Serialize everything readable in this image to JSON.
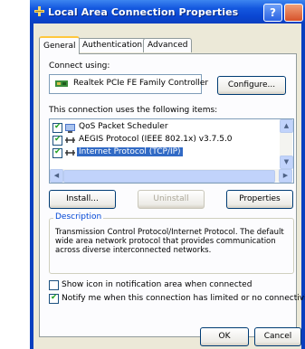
{
  "window": {
    "title": "Local Area Connection Properties",
    "help_label": "?"
  },
  "tabs": [
    {
      "label": "General",
      "active": true
    },
    {
      "label": "Authentication",
      "active": false
    },
    {
      "label": "Advanced",
      "active": false
    }
  ],
  "general": {
    "connect_using_label": "Connect using:",
    "adapter_name": "Realtek PCIe FE Family Controller",
    "configure_label": "Configure...",
    "items_label": "This connection uses the following items:",
    "items": [
      {
        "label": "QoS Packet Scheduler",
        "checked": true,
        "selected": false
      },
      {
        "label": "AEGIS Protocol (IEEE 802.1x) v3.7.5.0",
        "checked": true,
        "selected": false
      },
      {
        "label": "Internet Protocol (TCP/IP)",
        "checked": true,
        "selected": true
      }
    ],
    "install_label": "Install...",
    "uninstall_label": "Uninstall",
    "properties_label": "Properties",
    "description_label": "Description",
    "description_text": "Transmission Control Protocol/Internet Protocol. The default wide area network protocol that provides communication across diverse interconnected networks.",
    "show_icon_label": "Show icon in notification area when connected",
    "show_icon_checked": false,
    "notify_label": "Notify me when this connection has limited or no connectivity",
    "notify_checked": true
  },
  "footer": {
    "ok_label": "OK",
    "cancel_label": "Cancel"
  }
}
